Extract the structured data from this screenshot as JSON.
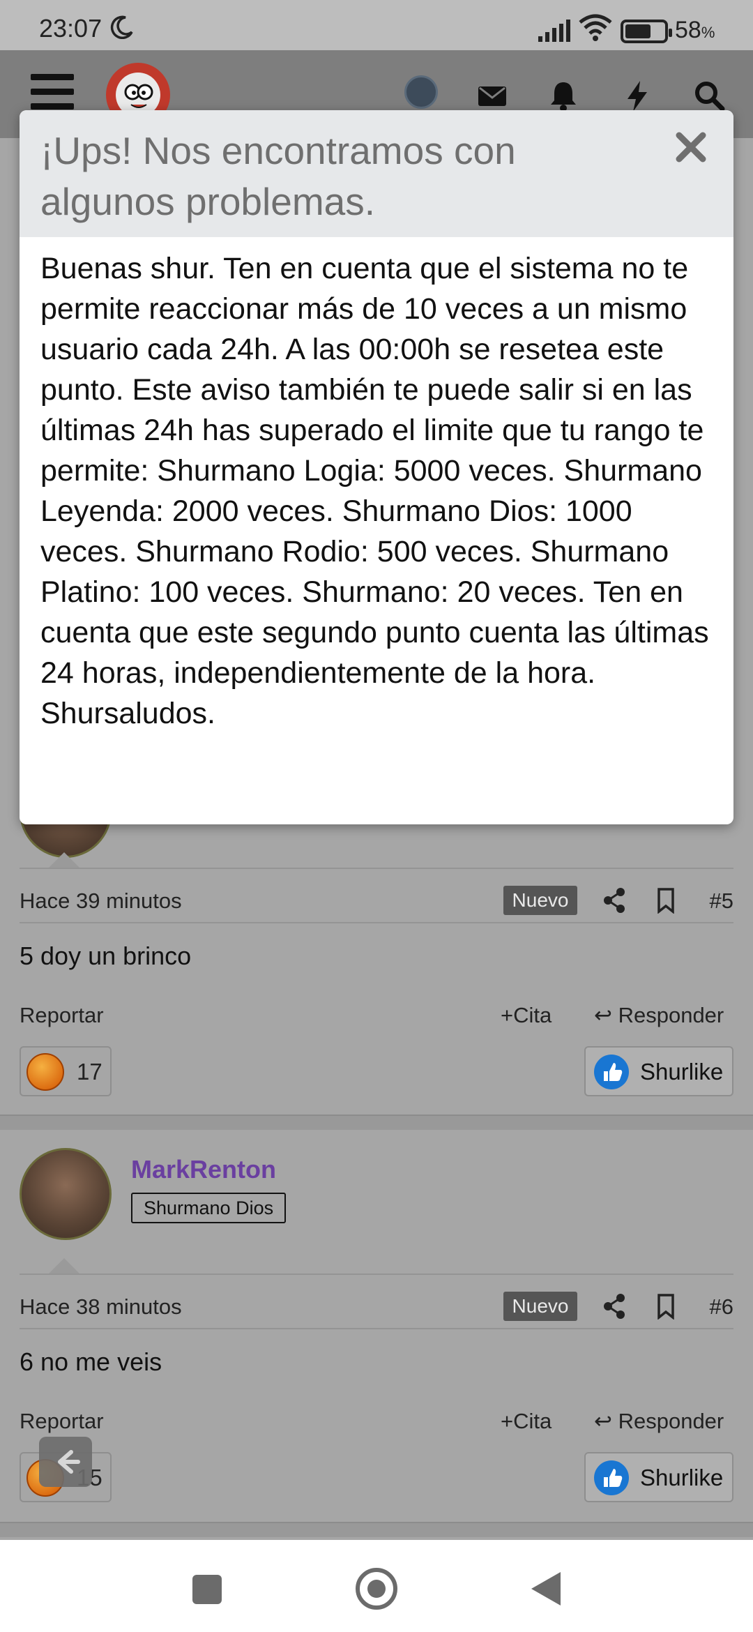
{
  "status_bar": {
    "time": "23:07",
    "battery_pct": "58",
    "battery_unit": "%",
    "icons": [
      "moon-icon",
      "signal-icon",
      "wifi-icon",
      "battery-icon"
    ]
  },
  "header": {
    "icons": [
      "menu-icon",
      "logo",
      "avatar",
      "mail-icon",
      "bell-icon",
      "bolt-icon",
      "search-icon"
    ]
  },
  "modal": {
    "title": "¡Ups! Nos encontramos con algunos problemas.",
    "body": "Buenas shur. Ten en cuenta que el sistema no te permite reaccionar más de 10 veces a un mismo usuario cada 24h. A las 00:00h se resetea este punto. Este aviso también te puede salir si en las últimas 24h has superado el limite que tu rango te permite: Shurmano Logia: 5000 veces. Shurmano Leyenda: 2000 veces. Shurmano Dios: 1000 veces. Shurmano Rodio: 500 veces. Shurmano Platino: 100 veces. Shurmano: 20 veces. Ten en cuenta que este segundo punto cuenta las últimas 24 horas, independientemente de la hora. Shursaludos.",
    "close_icon": "close-icon"
  },
  "posts": [
    {
      "time": "Hace 39 minutos",
      "badge": "Nuevo",
      "number": "#5",
      "text": "5 doy un brinco",
      "report": "Reportar",
      "quote": "Cita",
      "reply": "Responder",
      "reaction_count": "17",
      "like_label": "Shurlike"
    },
    {
      "author": "MarkRenton",
      "rank": "Shurmano Dios",
      "time": "Hace 38 minutos",
      "badge": "Nuevo",
      "number": "#6",
      "text": "6 no me veis",
      "report": "Reportar",
      "quote": "Cita",
      "reply": "Responder",
      "reaction_count": "15",
      "like_label": "Shurlike"
    }
  ],
  "colors": {
    "username": "#6a3fa0",
    "like_blue": "#1976d2",
    "logo_red": "#c0392b",
    "badge_bg": "#555555"
  }
}
